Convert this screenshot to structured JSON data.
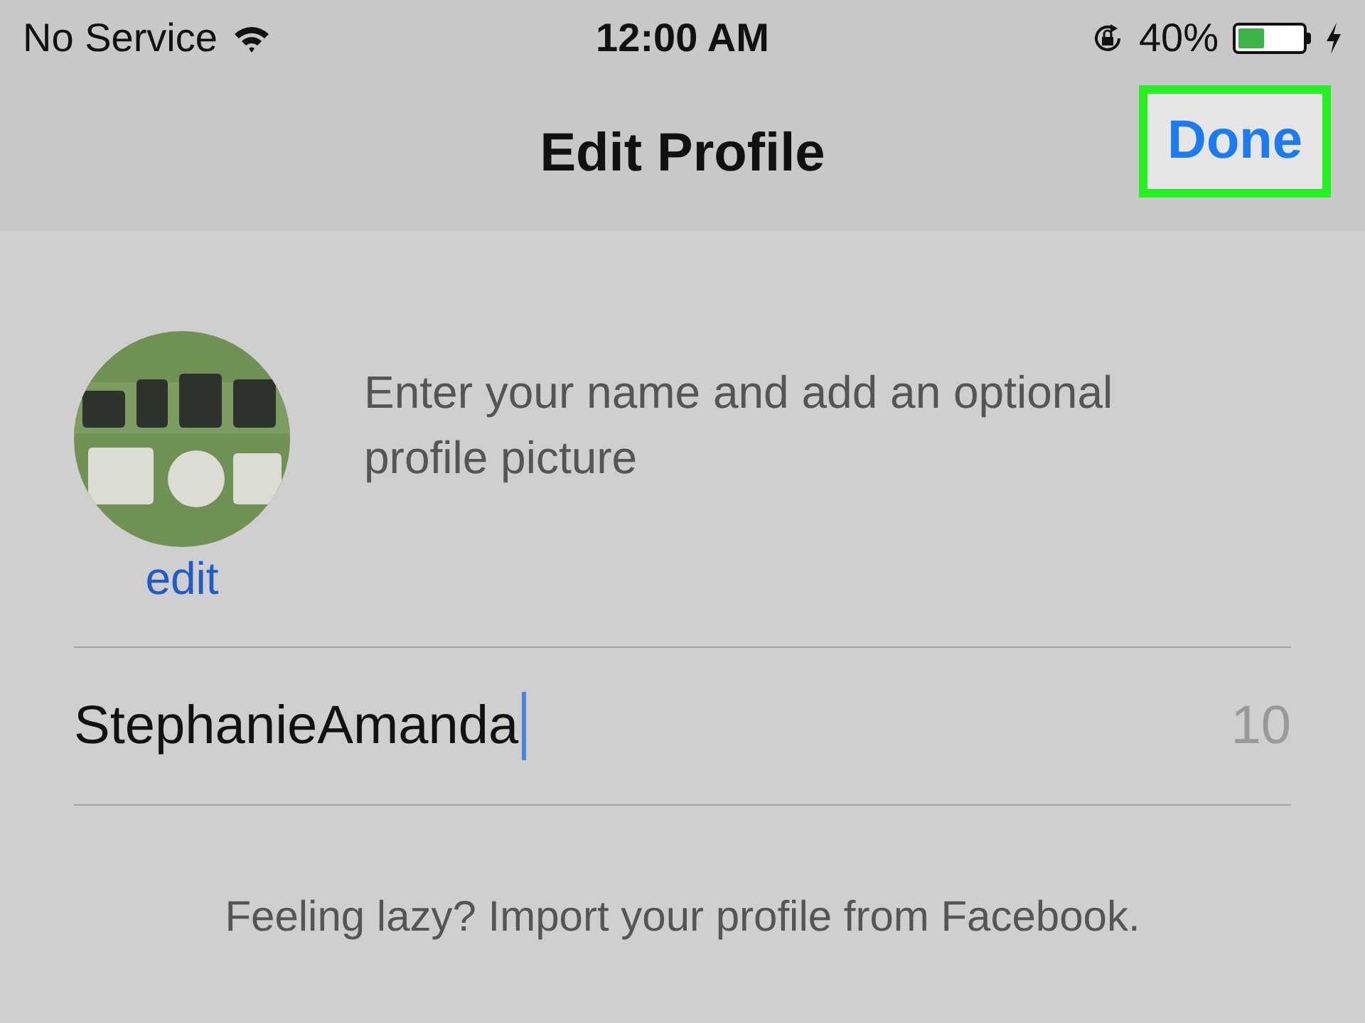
{
  "status_bar": {
    "carrier": "No Service",
    "time": "12:00 AM",
    "battery_percent": "40%",
    "charging": true
  },
  "nav_bar": {
    "title": "Edit Profile",
    "done": {
      "label": "Done",
      "highlighted": true
    }
  },
  "profile": {
    "edit_link": "edit",
    "hint": "Enter your name and add an optional profile picture"
  },
  "name_field": {
    "value": "StephanieAmanda",
    "remaining": "10",
    "focused": true
  },
  "footer_text": "Feeling lazy? Import your profile from Facebook."
}
